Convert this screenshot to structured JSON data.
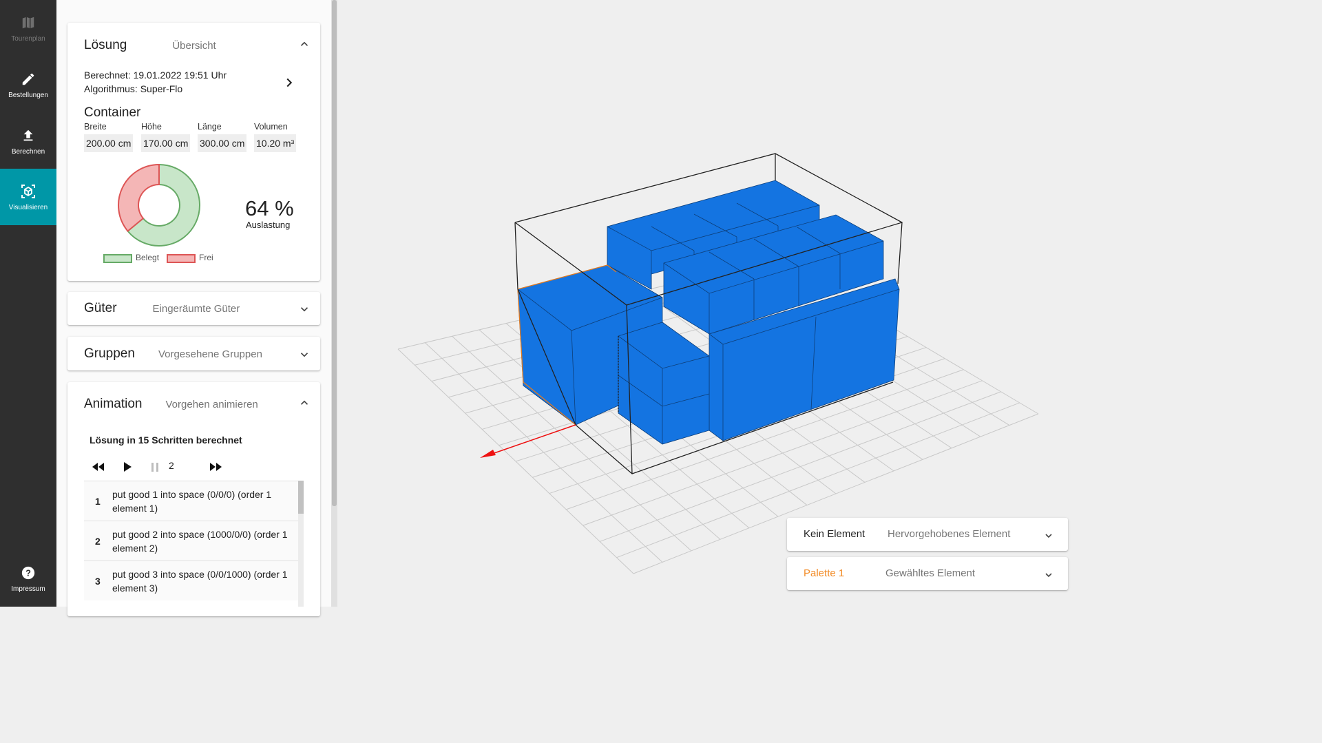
{
  "nav": {
    "items": [
      {
        "label": "Tourenplan",
        "icon": "map-icon",
        "state": "disabled"
      },
      {
        "label": "Bestellungen",
        "icon": "pencil-icon",
        "state": "normal"
      },
      {
        "label": "Berechnen",
        "icon": "upload-icon",
        "state": "normal"
      },
      {
        "label": "Visualisieren",
        "icon": "cube-scan-icon",
        "state": "active"
      }
    ],
    "impressum": {
      "label": "Impressum",
      "icon": "help-circle-icon"
    }
  },
  "loesung": {
    "title": "Lösung",
    "subtitle": "Übersicht",
    "computed": "Berechnet: 19.01.2022 19:51 Uhr",
    "algorithm": "Algorithmus: Super-Flo",
    "container_title": "Container",
    "dims": [
      {
        "label": "Breite",
        "value": "200.00 cm"
      },
      {
        "label": "Höhe",
        "value": "170.00 cm"
      },
      {
        "label": "Länge",
        "value": "300.00 cm"
      },
      {
        "label": "Volumen",
        "value": "10.20 m³"
      }
    ],
    "utilization_percent": "64 %",
    "utilization_fraction": 0.64,
    "utilization_label": "Auslastung",
    "legend": {
      "used": "Belegt",
      "free": "Frei"
    },
    "colors": {
      "used_fill": "#c8e6c9",
      "used_stroke": "#66aa66",
      "free_fill": "#f4b6b6",
      "free_stroke": "#dd5555"
    }
  },
  "gueter": {
    "title": "Güter",
    "subtitle": "Eingeräumte Güter"
  },
  "gruppen": {
    "title": "Gruppen",
    "subtitle": "Vorgesehene Gruppen"
  },
  "animation": {
    "title": "Animation",
    "subtitle": "Vorgehen animieren",
    "summary": "Lösung in 15 Schritten berechnet",
    "current_step": "2",
    "steps": [
      {
        "num": "1",
        "text": "put good 1 into space (0/0/0) (order 1 element 1)"
      },
      {
        "num": "2",
        "text": "put good 2 into space (1000/0/0) (order 1 element 2)"
      },
      {
        "num": "3",
        "text": "put good 3 into space (0/0/1000) (order 1 element 3)"
      }
    ]
  },
  "highlighted": {
    "value": "Kein Element",
    "label": "Hervorgehobenes Element"
  },
  "selected": {
    "value": "Palette 1",
    "label": "Gewähltes Element",
    "value_color": "#f28c28"
  },
  "scene_colors": {
    "box": "#1474e1",
    "selected_outline": "#e07a20",
    "grid": "#cccccc",
    "axis": "#ee1111"
  }
}
